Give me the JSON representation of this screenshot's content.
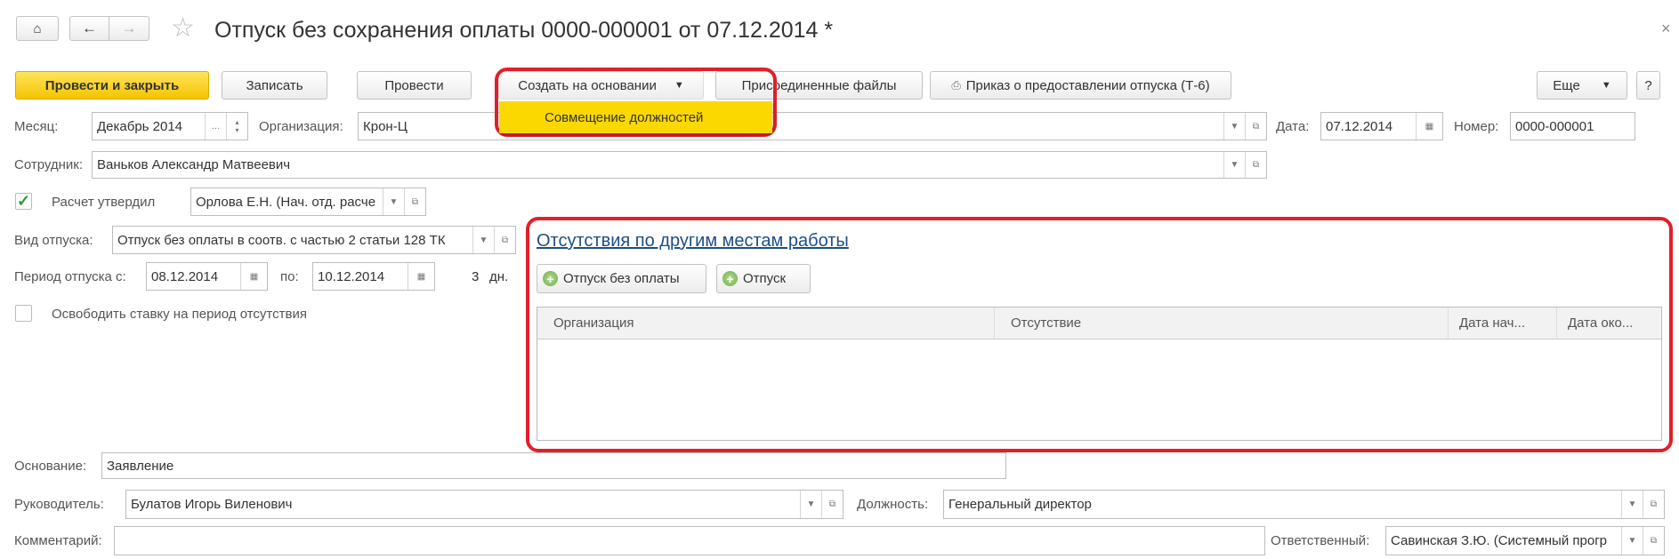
{
  "header": {
    "title": "Отпуск без сохранения оплаты 0000-000001 от 07.12.2014 *",
    "close": "×"
  },
  "toolbar": {
    "post_close": "Провести и закрыть",
    "save": "Записать",
    "post": "Провести",
    "create_based": "Создать на основании",
    "attached": "Присоединенные файлы",
    "order": "Приказ о предоставлении отпуска (Т-6)",
    "more": "Еще",
    "help": "?"
  },
  "dropdown": {
    "items": [
      "Совмещение должностей"
    ]
  },
  "form": {
    "month_label": "Месяц:",
    "month": "Декабрь 2014",
    "org_label": "Организация:",
    "org": "Крон-Ц",
    "date_label": "Дата:",
    "date": "07.12.2014",
    "number_label": "Номер:",
    "number": "0000-000001",
    "employee_label": "Сотрудник:",
    "employee": "Ваньков Александр Матвеевич",
    "approved_label": "Расчет утвердил",
    "approved_checked": true,
    "approved_by": "Орлова Е.Н. (Нач. отд. расче",
    "leave_type_label": "Вид отпуска:",
    "leave_type": "Отпуск без оплаты в соотв. с частью 2 статьи 128 ТК",
    "period_label": "Период отпуска с:",
    "period_from": "08.12.2014",
    "period_to_label": "по:",
    "period_to": "10.12.2014",
    "days": "3",
    "days_unit": "дн.",
    "release_label": "Освободить ставку на период отсутствия",
    "release_checked": false,
    "basis_label": "Основание:",
    "basis": "Заявление",
    "manager_label": "Руководитель:",
    "manager": "Булатов Игорь Виленович",
    "position_label": "Должность:",
    "position": "Генеральный директор",
    "comment_label": "Комментарий:",
    "comment": "",
    "responsible_label": "Ответственный:",
    "responsible": "Савинская З.Ю. (Системный прогр"
  },
  "absences": {
    "title": "Отсутствия по другим местам работы",
    "add_unpaid": "Отпуск без оплаты",
    "add_leave": "Отпуск",
    "columns": [
      "Организация",
      "Отсутствие",
      "Дата нач...",
      "Дата око..."
    ],
    "rows": []
  },
  "colors": {
    "highlight": "#e0202a",
    "primary": "#f5c400",
    "link": "#1c4e8a"
  }
}
